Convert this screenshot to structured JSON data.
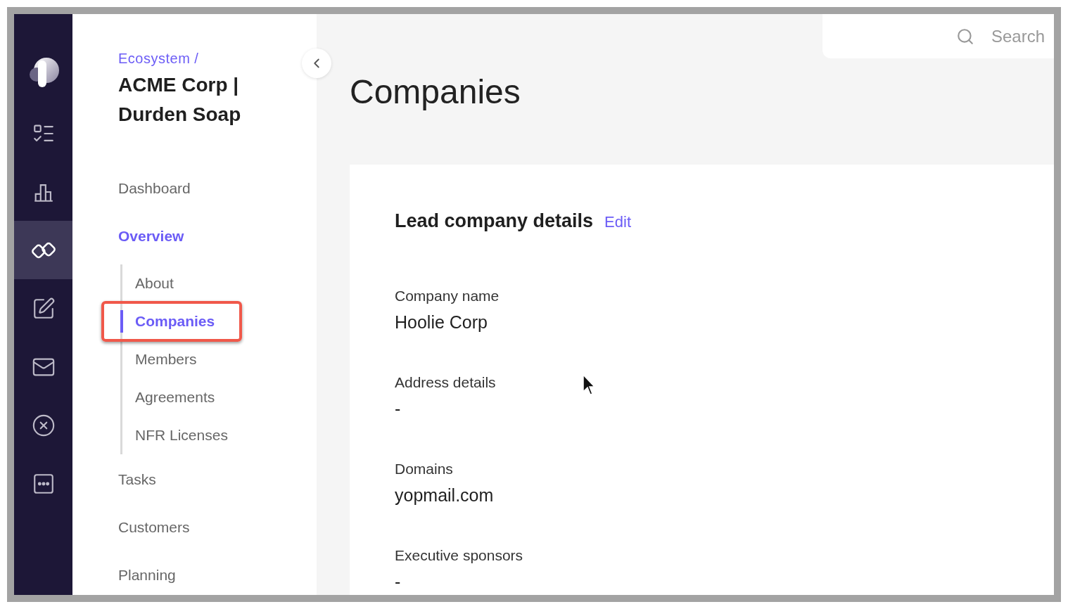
{
  "rail": [
    {
      "kind": "tasks",
      "selected": false
    },
    {
      "kind": "chart",
      "selected": false
    },
    {
      "kind": "link",
      "selected": true
    },
    {
      "kind": "edit",
      "selected": false
    },
    {
      "kind": "mail",
      "selected": false
    },
    {
      "kind": "blocked",
      "selected": false
    },
    {
      "kind": "more",
      "selected": false
    }
  ],
  "sidebar": {
    "breadcrumb": "Ecosystem /",
    "title": "ACME Corp | Durden Soap",
    "items": [
      {
        "label": "Dashboard",
        "selected": false
      },
      {
        "label": "Overview",
        "selected": true,
        "children": [
          {
            "label": "About",
            "selected": false
          },
          {
            "label": "Companies",
            "selected": true,
            "highlighted": true
          },
          {
            "label": "Members",
            "selected": false
          },
          {
            "label": "Agreements",
            "selected": false
          },
          {
            "label": "NFR Licenses",
            "selected": false
          }
        ]
      },
      {
        "label": "Tasks",
        "selected": false
      },
      {
        "label": "Customers",
        "selected": false
      },
      {
        "label": "Planning",
        "selected": false
      }
    ]
  },
  "search": {
    "placeholder": "Search"
  },
  "page_title": "Companies",
  "card": {
    "heading": "Lead company details",
    "edit_link": "Edit",
    "fields": [
      {
        "label": "Company name",
        "value": "Hoolie Corp"
      },
      {
        "label": "Address details",
        "value": "-"
      },
      {
        "label": "Domains",
        "value": "yopmail.com"
      },
      {
        "label": "Executive sponsors",
        "value": "-"
      }
    ]
  }
}
